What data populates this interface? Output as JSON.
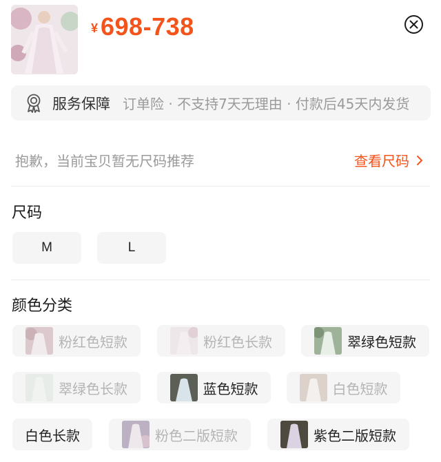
{
  "product": {
    "currency": "¥",
    "price": "698-738"
  },
  "service": {
    "label": "服务保障",
    "description": "订单险 · 不支持7天无理由 · 付款后45天内发货"
  },
  "size_hint": {
    "text": "抱歉，当前宝贝暂无尺码推荐",
    "link": "查看尺码"
  },
  "sizes": {
    "title": "尺码",
    "options": [
      {
        "label": "M"
      },
      {
        "label": "L"
      }
    ]
  },
  "colors": {
    "title": "颜色分类",
    "options": [
      {
        "label": "粉红色短款",
        "available": false
      },
      {
        "label": "粉红色长款",
        "available": false
      },
      {
        "label": "翠绿色短款",
        "available": true
      },
      {
        "label": "翠绿色长款",
        "available": false
      },
      {
        "label": "蓝色短款",
        "available": true
      },
      {
        "label": "白色短款",
        "available": false
      },
      {
        "label": "白色长款",
        "available": true
      },
      {
        "label": "粉色二版短款",
        "available": false
      },
      {
        "label": "紫色二版短款",
        "available": true
      }
    ]
  },
  "theme": {
    "accent": "#f2541b",
    "chip_bg": "#f5f5f5",
    "disabled_text": "#b4b4b4"
  }
}
